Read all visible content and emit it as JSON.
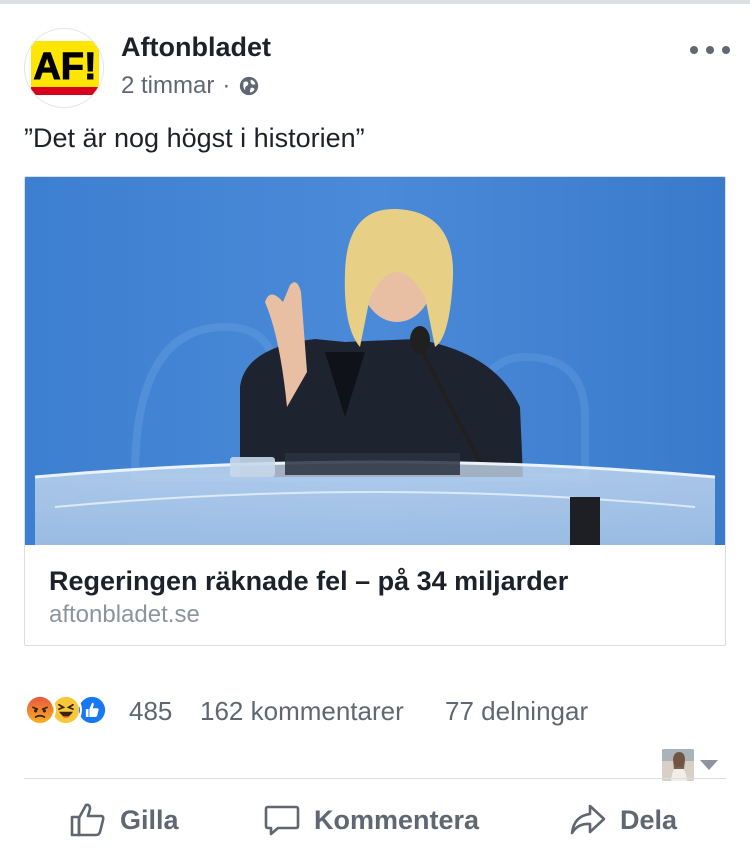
{
  "post": {
    "page_name": "Aftonbladet",
    "time": "2 timmar",
    "separator": "·",
    "audience_icon": "globe-icon",
    "more_icon": "more-options-icon",
    "text": "”Det är nog högst i historien”",
    "logo_text": "AF!",
    "colors": {
      "logo_yellow": "#ffe600",
      "logo_red": "#d9001b",
      "text_primary": "#1d2129",
      "text_secondary": "#616770",
      "link_domain": "#8d949e",
      "like_blue": "#1877f2"
    }
  },
  "link_card": {
    "title": "Regeringen räknade fel – på 34 miljarder",
    "domain": "aftonbladet.se"
  },
  "stats": {
    "reactions": [
      "angry-reaction-icon",
      "haha-reaction-icon",
      "like-reaction-icon"
    ],
    "reaction_count": "485",
    "comments": "162 kommentarer",
    "shares": "77 delningar"
  },
  "actions": {
    "like": {
      "label": "Gilla",
      "icon": "thumbs-up-icon"
    },
    "comment": {
      "label": "Kommentera",
      "icon": "comment-bubble-icon"
    },
    "share": {
      "label": "Dela",
      "icon": "share-arrow-icon"
    }
  }
}
